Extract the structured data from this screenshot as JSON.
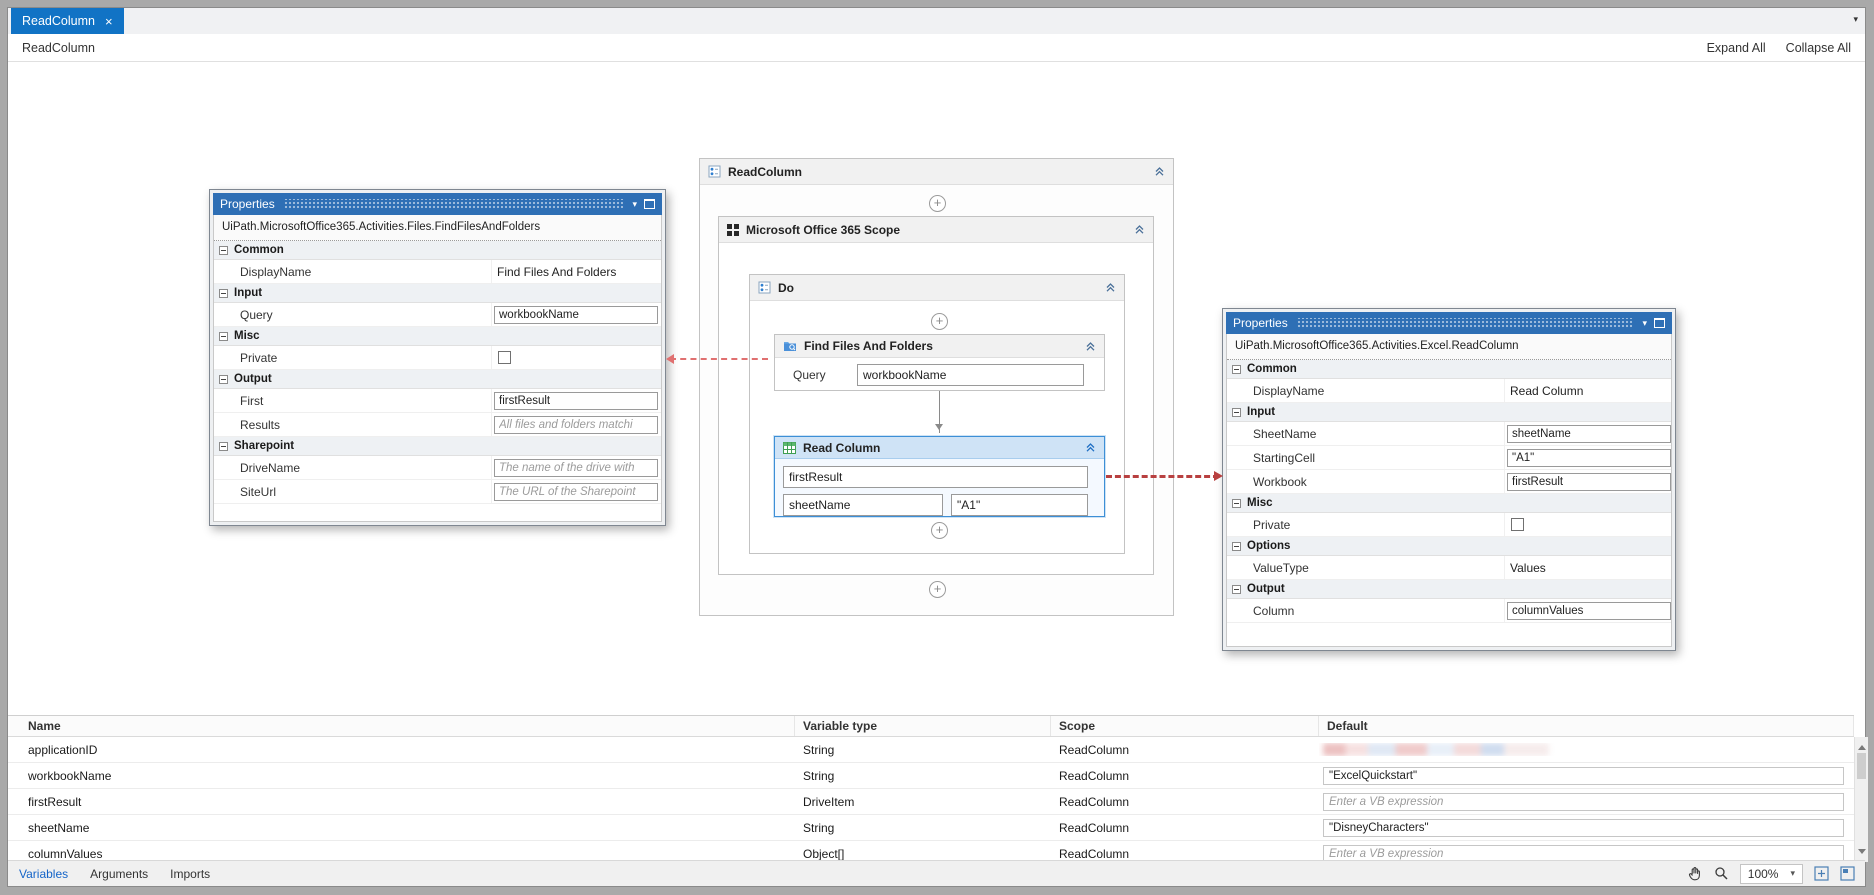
{
  "tab_bar": {
    "active_tab_label": "ReadColumn",
    "close_glyph": "×",
    "overflow_chevron": "▾"
  },
  "breadcrumb_bar": {
    "breadcrumb": "ReadColumn",
    "expand_all_label": "Expand All",
    "collapse_all_label": "Collapse All"
  },
  "workflow": {
    "plus_glyph": "+",
    "root_title": "ReadColumn",
    "scope_title": "Microsoft Office 365 Scope",
    "do_title": "Do",
    "find_files": {
      "title": "Find Files And Folders",
      "query_label": "Query",
      "query_value": "workbookName"
    },
    "read_column": {
      "title": "Read Column",
      "workbook_value": "firstResult",
      "sheet_value": "sheetName",
      "cell_value": "\"A1\""
    }
  },
  "left_panel": {
    "title": "Properties",
    "dropdown_glyph": "▾",
    "type_name": "UiPath.MicrosoftOffice365.Activities.Files.FindFilesAndFolders",
    "ellipsis_label": "...",
    "sections": {
      "common": "Common",
      "input": "Input",
      "misc": "Misc",
      "output": "Output",
      "sharepoint": "Sharepoint"
    },
    "rows": {
      "display_name": {
        "label": "DisplayName",
        "value": "Find Files And Folders"
      },
      "query": {
        "label": "Query",
        "value": "workbookName"
      },
      "private": {
        "label": "Private"
      },
      "first": {
        "label": "First",
        "value": "firstResult"
      },
      "results": {
        "label": "Results",
        "placeholder": "All files and folders matchi"
      },
      "drive_name": {
        "label": "DriveName",
        "placeholder": "The name of the drive with"
      },
      "site_url": {
        "label": "SiteUrl",
        "placeholder": "The URL of the Sharepoint"
      }
    }
  },
  "right_panel": {
    "title": "Properties",
    "dropdown_glyph": "▾",
    "type_name": "UiPath.MicrosoftOffice365.Activities.Excel.ReadColumn",
    "ellipsis_label": "...",
    "sections": {
      "common": "Common",
      "input": "Input",
      "misc": "Misc",
      "options": "Options",
      "output": "Output"
    },
    "rows": {
      "display_name": {
        "label": "DisplayName",
        "value": "Read Column"
      },
      "sheet_name": {
        "label": "SheetName",
        "value": "sheetName"
      },
      "starting_cell": {
        "label": "StartingCell",
        "value": "\"A1\""
      },
      "workbook": {
        "label": "Workbook",
        "value": "firstResult"
      },
      "private": {
        "label": "Private"
      },
      "value_type": {
        "label": "ValueType",
        "value": "Values"
      },
      "column": {
        "label": "Column",
        "value": "columnValues"
      }
    }
  },
  "variables_panel": {
    "columns": [
      "Name",
      "Variable type",
      "Scope",
      "Default"
    ],
    "rows": [
      {
        "name": "applicationID",
        "type": "String",
        "scope": "ReadColumn",
        "default": ""
      },
      {
        "name": "workbookName",
        "type": "String",
        "scope": "ReadColumn",
        "default": "\"ExcelQuickstart\""
      },
      {
        "name": "firstResult",
        "type": "DriveItem",
        "scope": "ReadColumn",
        "default": "Enter a VB expression"
      },
      {
        "name": "sheetName",
        "type": "String",
        "scope": "ReadColumn",
        "default": "\"DisneyCharacters\""
      },
      {
        "name": "columnValues",
        "type": "Object[]",
        "scope": "ReadColumn",
        "default": "Enter a VB expression"
      }
    ]
  },
  "status_bar": {
    "tabs": [
      "Variables",
      "Arguments",
      "Imports"
    ],
    "zoom_level": "100%",
    "zoom_dropdown_glyph": "▾"
  },
  "colors": {
    "active_tab_blue": "#1173c5",
    "panel_title_blue": "#2e6fb5",
    "selection_blue": "#3d8fd6",
    "arrow_red": "#b84040"
  }
}
